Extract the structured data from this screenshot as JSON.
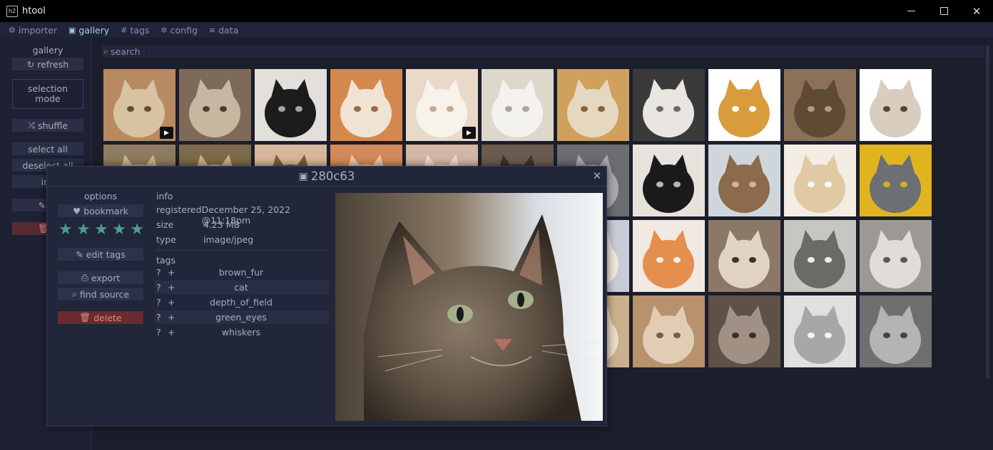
{
  "window": {
    "app_icon_text": "h2",
    "title": "htool"
  },
  "menu": [
    {
      "icon": "⚙",
      "label": "importer"
    },
    {
      "icon": "▣",
      "label": "gallery"
    },
    {
      "icon": "#",
      "label": "tags"
    },
    {
      "icon": "✲",
      "label": "config"
    },
    {
      "icon": "≡",
      "label": "data"
    }
  ],
  "sidebar": {
    "title": "gallery",
    "refresh": "refresh",
    "selection_mode": [
      "selection",
      "mode"
    ],
    "shuffle": "shuffle",
    "select_all": "select all",
    "deselect_all": "deselect all",
    "invert": "inv",
    "edit": "m",
    "delete": "d"
  },
  "search": {
    "label": "search",
    "placeholder": ""
  },
  "colors": {
    "accent": "#9fd6d0",
    "star": "#4b9e90",
    "danger": "#6b2a2f"
  },
  "modal": {
    "title": "280c63",
    "options_title": "options",
    "bookmark": "bookmark",
    "rating_stars": 5,
    "edit_tags": "edit tags",
    "export": "export",
    "find_source": "find source",
    "delete": "delete",
    "info_title": "info",
    "info": [
      {
        "key": "registered",
        "value": "December 25, 2022 @11:18pm"
      },
      {
        "key": "size",
        "value": "4.23 MB"
      },
      {
        "key": "type",
        "value": "image/jpeg"
      }
    ],
    "tags_title": "tags",
    "tags": [
      "brown_fur",
      "cat",
      "depth_of_field",
      "green_eyes",
      "whiskers"
    ],
    "tag_q": "?",
    "tag_plus": "+"
  },
  "thumbnails": [
    {
      "colors": [
        "#b88a62",
        "#d7c3a4",
        "#6d4a31"
      ],
      "badge": "play"
    },
    {
      "colors": [
        "#7d6a58",
        "#c8b7a0",
        "#4e3e30"
      ]
    },
    {
      "colors": [
        "#e3dfda",
        "#1c1c1c",
        "#a9a39c"
      ]
    },
    {
      "colors": [
        "#d4884e",
        "#f1e3d4",
        "#98674a"
      ]
    },
    {
      "colors": [
        "#e9d9c9",
        "#f7f2ea",
        "#c7a98e"
      ],
      "badge": "play"
    },
    {
      "colors": [
        "#ded8cc",
        "#f4f2ee",
        "#b1a48f"
      ]
    },
    {
      "colors": [
        "#cfa15d",
        "#e6d8c0",
        "#8c6134"
      ]
    },
    {
      "colors": [
        "#3a3a3a",
        "#e9e6e2",
        "#6f6a66"
      ]
    },
    {
      "colors": [
        "#ffffff",
        "#d99c3d",
        "#ffffff"
      ]
    },
    {
      "colors": [
        "#8a7158",
        "#5f4a35",
        "#b49c7a"
      ]
    },
    {
      "colors": [
        "#ffffff",
        "#d8cdbf",
        "#5a4434"
      ]
    },
    {
      "colors": [
        "#8f7c60",
        "#c8b592",
        "#5d4d36"
      ]
    },
    {
      "colors": [
        "#7d6a4c",
        "#ccb38b",
        "#4e3e2a"
      ]
    },
    {
      "colors": [
        "#d6b79a",
        "#7c5e44",
        "#e9d6c4"
      ]
    },
    {
      "colors": [
        "#d48a5a",
        "#efc7a7",
        "#a8623c"
      ]
    },
    {
      "colors": [
        "#d3b7a6",
        "#efdcd1",
        "#a88b79"
      ]
    },
    {
      "colors": [
        "#6b5c4f",
        "#3d342d",
        "#a39484"
      ]
    },
    {
      "colors": [
        "#6c6d70",
        "#a9aaad",
        "#434446"
      ]
    },
    {
      "colors": [
        "#e6e2dc",
        "#1a1a1a",
        "#bdb6ad"
      ]
    },
    {
      "colors": [
        "#cfd6db",
        "#8c6a4c",
        "#d5b196"
      ]
    },
    {
      "colors": [
        "#f3ede3",
        "#e1c9a3",
        "#fdfaf5"
      ]
    },
    {
      "colors": [
        "#e0b420",
        "#6c6f73",
        "#d8ac1f"
      ]
    },
    {
      "colors": [
        "#6e6e6e",
        "#9c9c9c",
        "#4b4b4b"
      ]
    },
    {
      "colors": [
        "#c98521",
        "#f0c77d",
        "#7d4b10"
      ]
    },
    {
      "colors": [
        "#b98a51",
        "#e3c08f",
        "#7a5430"
      ]
    },
    {
      "colors": [
        "#9e9a95",
        "#e3e0dc",
        "#5f5a55"
      ]
    },
    {
      "colors": [
        "#7c6858",
        "#4d4035",
        "#c5b3a1"
      ]
    },
    {
      "colors": [
        "#5f8a3e",
        "#9c9a94",
        "#3c5a22"
      ]
    },
    {
      "colors": [
        "#c8ccd6",
        "#efe8dc",
        "#3f4a6b"
      ]
    },
    {
      "colors": [
        "#f1e9e2",
        "#e48f4d",
        "#f7efe8"
      ]
    },
    {
      "colors": [
        "#8b7867",
        "#e0d3c4",
        "#3e332a"
      ]
    },
    {
      "colors": [
        "#c7c6c1",
        "#6b6a66",
        "#ecebe7"
      ]
    },
    {
      "colors": [
        "#9c9994",
        "#e0ddd8",
        "#5a5753"
      ]
    },
    {
      "colors": [
        "#e8e6e3",
        "#9aa2ab",
        "#f6f5f3"
      ]
    },
    {
      "colors": [
        "#dcd1c5",
        "#f3efea",
        "#a89f96"
      ],
      "badge": "clip"
    },
    {
      "colors": [
        "#c5c6c4",
        "#f2f2f0",
        "#8b8c8a"
      ],
      "badge": "play"
    },
    {
      "colors": [
        "#c97f47",
        "#efbb8a",
        "#8c4e25"
      ]
    },
    {
      "colors": [
        "#6e5a48",
        "#b09880",
        "#3b2f26"
      ]
    },
    {
      "colors": [
        "#4f4a45",
        "#8e8881",
        "#2d2a27"
      ]
    },
    {
      "colors": [
        "#cbb08e",
        "#eadcc7",
        "#8e7458"
      ]
    },
    {
      "colors": [
        "#b7926c",
        "#e1ccb4",
        "#7b5c40"
      ]
    },
    {
      "colors": [
        "#5e5148",
        "#a09184",
        "#382f28"
      ]
    },
    {
      "colors": [
        "#e0e0de",
        "#a7a7a5",
        "#f3f3f1"
      ]
    },
    {
      "colors": [
        "#6f6f71",
        "#b4b4b6",
        "#444446"
      ]
    }
  ]
}
